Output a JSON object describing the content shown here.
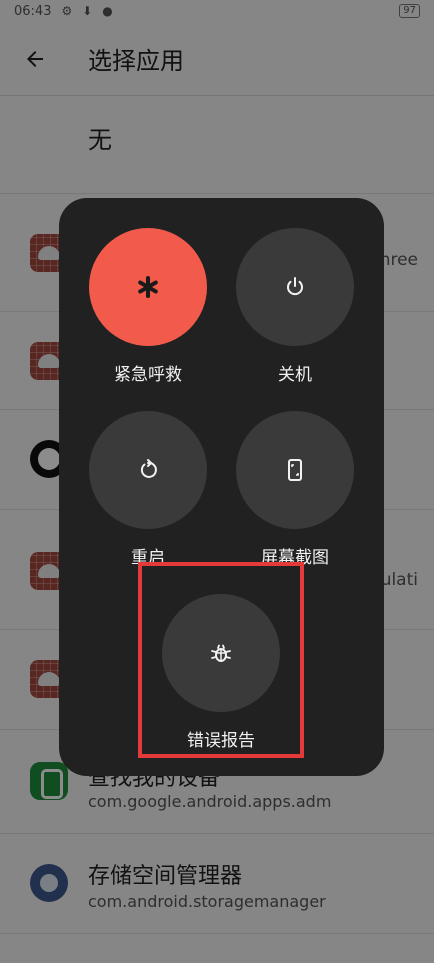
{
  "status_bar": {
    "time": "06:43",
    "battery": "97"
  },
  "header": {
    "title": "选择应用"
  },
  "list": {
    "none_label": "无",
    "peek_row1_side": "hree",
    "peek_row4_side": "ulati",
    "find_device": {
      "name": "查找我的设备",
      "package": "com.google.android.apps.adm"
    },
    "storage_manager": {
      "name": "存储空间管理器",
      "package": "com.android.storagemanager"
    }
  },
  "power_menu": {
    "emergency": "紧急呼救",
    "power_off": "关机",
    "restart": "重启",
    "screenshot": "屏幕截图",
    "bug_report": "错误报告"
  },
  "colors": {
    "emergency": "#f25b4c",
    "menu_bg": "#212121",
    "button_bg": "#3a3a3a",
    "highlight": "#e43a3a"
  }
}
